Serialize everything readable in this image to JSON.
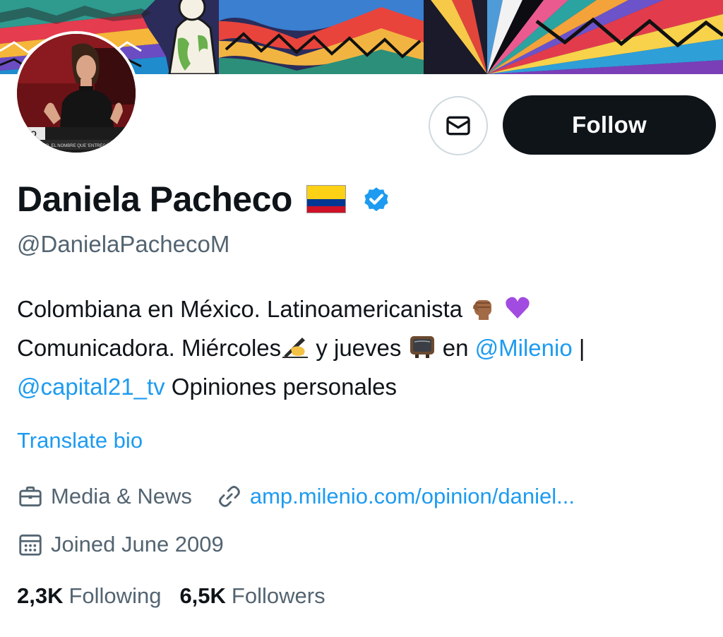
{
  "profile": {
    "display_name": "Daniela Pacheco",
    "handle": "@DanielaPachecoM",
    "flag_icon": "colombia-flag-icon",
    "verified_icon": "verified-badge-icon"
  },
  "buttons": {
    "message_icon": "envelope-icon",
    "follow_label": "Follow"
  },
  "bio": {
    "line1_text": "Colombiana en México. Latinoamericanista",
    "line1_emojis": [
      "raised-fist-icon",
      "purple-heart-icon"
    ],
    "line2_text_a": "Comunicadora. Miércoles",
    "line2_emoji_1": "writing-hand-icon",
    "line2_text_b": "y jueves",
    "line2_emoji_2": "television-icon",
    "line2_text_c": "en",
    "mention_1": "@Milenio",
    "separator": "|",
    "mention_2": "@capital21_tv",
    "line3_text": "Opiniones personales"
  },
  "translate_label": "Translate bio",
  "meta": {
    "category": "Media & News",
    "website": "amp.milenio.com/opinion/daniel...",
    "joined": "Joined June 2009"
  },
  "stats": {
    "following_count": "2,3K",
    "following_label": "Following",
    "followers_count": "6,5K",
    "followers_label": "Followers"
  },
  "avatar_caption": "ECO",
  "avatar_ticker": "DO DEL MAZO, EL NOMBRE QUE 'ENTREGÓ",
  "colors": {
    "accent": "#1d9bf0",
    "text_primary": "#0f1419",
    "text_secondary": "#536471",
    "follow_bg": "#0f1419"
  }
}
